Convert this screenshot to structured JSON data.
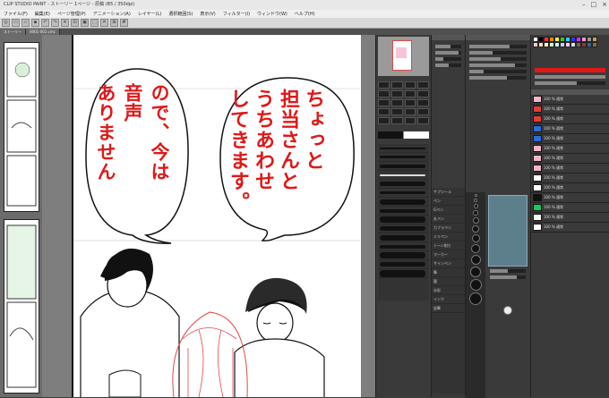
{
  "titlebar": {
    "text": "CLIP STUDIO PAINT - ストーリー 1ページ - 原稿 (B5 / 350dpi)"
  },
  "menu": [
    "ファイル(F)",
    "編集(E)",
    "ページ管理(P)",
    "アニメーション(A)",
    "レイヤー(L)",
    "選択範囲(S)",
    "表示(V)",
    "フィルター(I)",
    "ウィンドウ(W)",
    "ヘルプ(H)"
  ],
  "tabs": [
    "ストーリー",
    "0001-002.cmc"
  ],
  "canvas": {
    "bubble1_text": [
      "ちょっと",
      "担当さんと",
      "うちあわせ",
      "してきます。"
    ],
    "bubble2_text": [
      "ので、今は",
      "音声",
      "ありません"
    ]
  },
  "colors": {
    "accent_red": "#e01818",
    "panel_bg": "#3a3a3a",
    "canvas_bg": "#7e7e7e"
  },
  "layers": [
    {
      "name": "100 % 通常",
      "thumb": "#f2b6c9"
    },
    {
      "name": "100 % 通常",
      "thumb": "#e63b3b"
    },
    {
      "name": "100 % 通常",
      "thumb": "#e63b3b"
    },
    {
      "name": "100 % 通常",
      "thumb": "#2e6bd6"
    },
    {
      "name": "100 % 通常",
      "thumb": "#2e6bd6"
    },
    {
      "name": "100 % 通常",
      "thumb": "#f2b6c9"
    },
    {
      "name": "100 % 通常",
      "thumb": "#f2b6c9"
    },
    {
      "name": "100 % 通常",
      "thumb": "#f2b6c9"
    },
    {
      "name": "100 % 通常",
      "thumb": "#ffffff"
    },
    {
      "name": "100 % 通常",
      "thumb": "#ffffff"
    },
    {
      "name": "100 % 通常",
      "thumb": "#111111"
    },
    {
      "name": "100 % 通常",
      "thumb": "#1bc95a"
    },
    {
      "name": "100 % 通常",
      "thumb": "#ffffff"
    },
    {
      "name": "100 % 通常",
      "thumb": "#ffffff"
    }
  ],
  "brushes": [
    "サブツール",
    "ペン",
    "Gペン",
    "丸ペン",
    "カブラペン",
    "ミリペン",
    "トーン削り",
    "マーカー",
    "サインペン",
    "筆",
    "墨",
    "水彩",
    "インク",
    "鉛筆"
  ]
}
